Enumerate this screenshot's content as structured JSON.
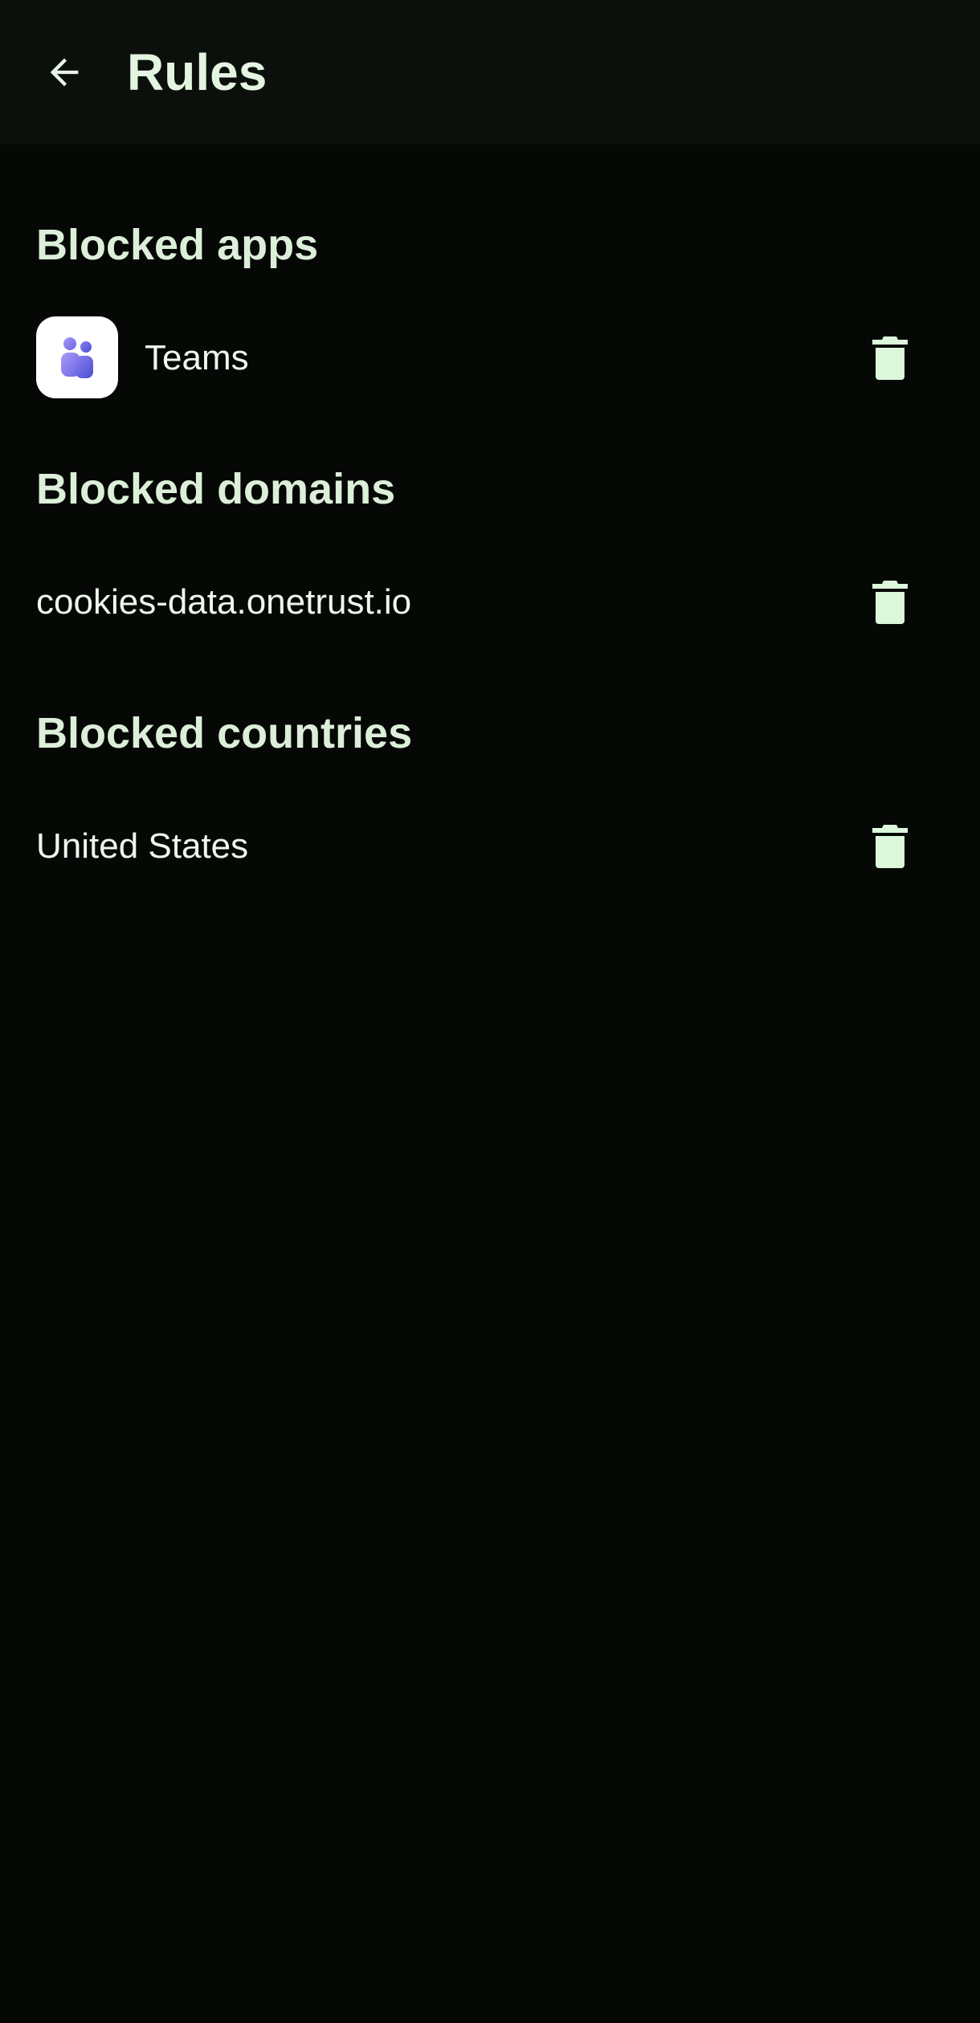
{
  "header": {
    "title": "Rules",
    "back_icon": "arrow-left-icon"
  },
  "sections": {
    "apps": {
      "title": "Blocked apps",
      "items": [
        {
          "label": "Teams",
          "icon": "teams-app-icon"
        }
      ]
    },
    "domains": {
      "title": "Blocked domains",
      "items": [
        {
          "label": "cookies-data.onetrust.io"
        }
      ]
    },
    "countries": {
      "title": "Blocked countries",
      "items": [
        {
          "label": "United States"
        }
      ]
    }
  },
  "colors": {
    "background": "#060806",
    "app_bar": "#0c100c",
    "accent_text": "#e3f5e1",
    "trash_icon": "#dcf7dc",
    "teams_purple": "#5b5fdc"
  }
}
